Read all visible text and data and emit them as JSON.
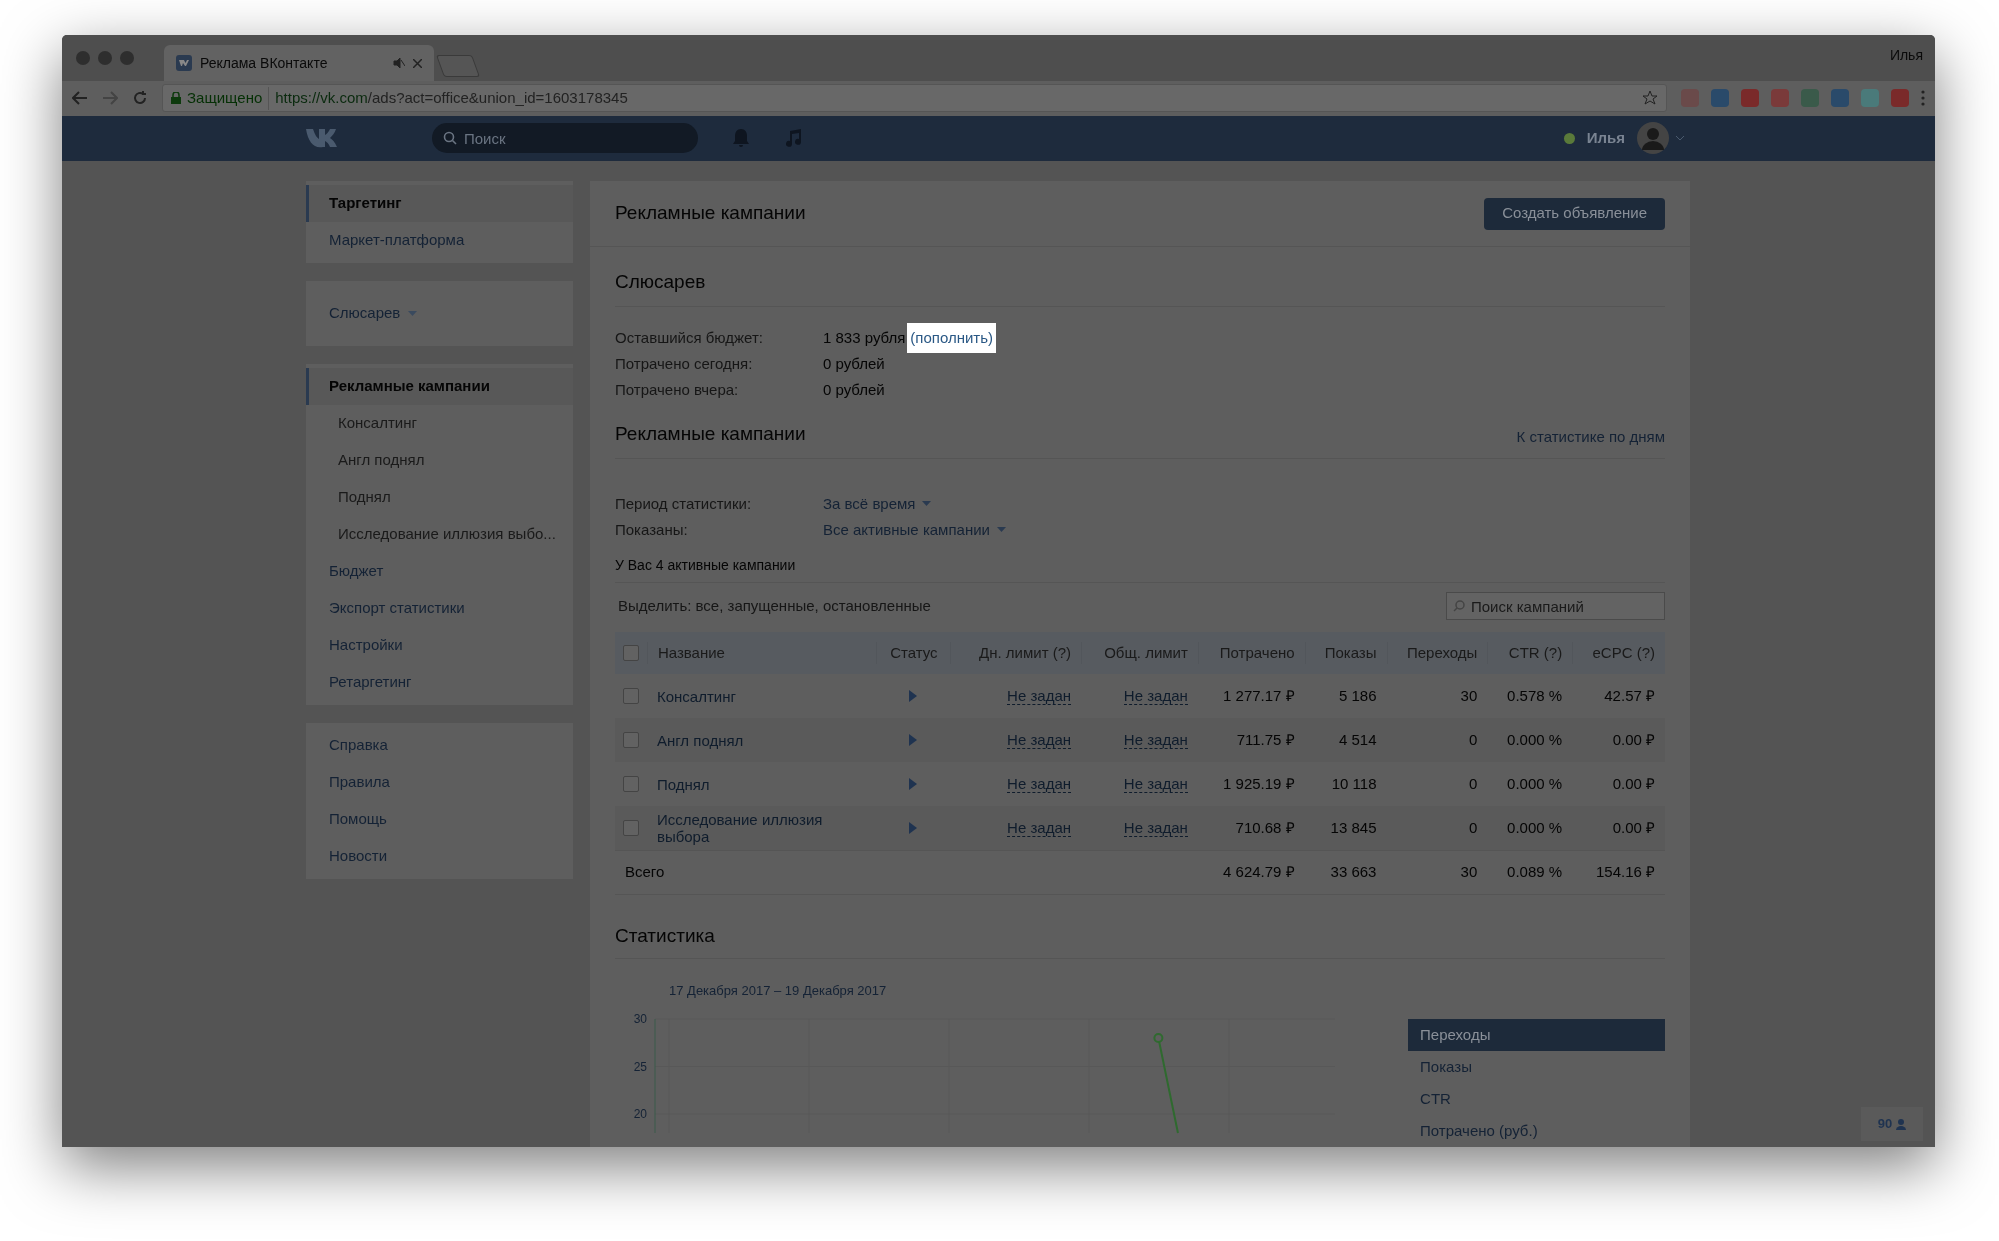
{
  "browser": {
    "tabs": [
      {
        "title": "Реклама ВКонтакте",
        "selected": true
      }
    ],
    "profile": "Илья",
    "security": "Защищено",
    "url_host": "https://vk.com",
    "url_path": "/ads?act=office&union_id=1603178345"
  },
  "vk_header": {
    "search": {
      "placeholder": "Поиск"
    },
    "user": "Илья",
    "online": true
  },
  "sidebar": {
    "groups": [
      {
        "items": [
          {
            "label": "Таргетинг",
            "selected": true
          },
          {
            "label": "Маркет-платформа",
            "selected": false
          }
        ]
      },
      {
        "items": [
          {
            "label": "Слюсарев",
            "kind": "dropdown",
            "selected": false
          }
        ]
      },
      {
        "items": [
          {
            "label": "Рекламные кампании",
            "selected": true,
            "children": [
              {
                "label": "Консалтинг",
                "selected": false
              },
              {
                "label": "Англ поднял",
                "selected": false
              },
              {
                "label": "Поднял",
                "selected": false
              },
              {
                "label": "Исследование иллюзия выбо...",
                "selected": false
              }
            ]
          },
          {
            "label": "Бюджет",
            "selected": false
          },
          {
            "label": "Экспорт статистики",
            "selected": false
          },
          {
            "label": "Настройки",
            "selected": false
          },
          {
            "label": "Ретаргетинг",
            "selected": false
          }
        ]
      },
      {
        "items": [
          {
            "label": "Справка",
            "selected": false
          },
          {
            "label": "Правила",
            "selected": false
          },
          {
            "label": "Помощь",
            "selected": false
          },
          {
            "label": "Новости",
            "selected": false
          }
        ]
      }
    ]
  },
  "main": {
    "title": "Рекламные кампании",
    "create_button": "Создать объявление",
    "account": {
      "title": "Слюсарев",
      "rows": [
        {
          "label": "Оставшийся бюджет:",
          "value": "1 833 рубля",
          "link": "(пополнить)",
          "highlighted": true
        },
        {
          "label": "Потрачено сегодня:",
          "value": "0 рублей"
        },
        {
          "label": "Потрачено вчера:",
          "value": "0 рублей"
        }
      ]
    },
    "campaigns": {
      "title": "Рекламные кампании",
      "stats_link": "К статистике по дням",
      "filters": [
        {
          "label": "Период статистики:",
          "value": "За всё время"
        },
        {
          "label": "Показаны:",
          "value": "Все активные кампании"
        }
      ],
      "count": "У Вас 4 активные кампании",
      "select_line": "Выделить: все, запущенные, остановленные",
      "search": {
        "placeholder": "Поиск кампаний"
      },
      "table": {
        "select_all": {
          "checked": false
        },
        "columns": [
          "Название",
          "Статус",
          "Дн. лимит (?)",
          "Общ. лимит",
          "Потрачено",
          "Показы",
          "Переходы",
          "CTR (?)",
          "eCPC (?)"
        ],
        "rows": [
          {
            "checked": false,
            "name": "Консалтинг",
            "running": true,
            "day_limit": "Не задан",
            "total_limit": "Не задан",
            "spent": "1 277.17 ₽",
            "shows": "5 186",
            "clicks": "30",
            "ctr": "0.578 %",
            "ecpc": "42.57 ₽"
          },
          {
            "checked": false,
            "name": "Англ поднял",
            "running": true,
            "day_limit": "Не задан",
            "total_limit": "Не задан",
            "spent": "711.75 ₽",
            "shows": "4 514",
            "clicks": "0",
            "ctr": "0.000 %",
            "ecpc": "0.00 ₽"
          },
          {
            "checked": false,
            "name": "Поднял",
            "running": true,
            "day_limit": "Не задан",
            "total_limit": "Не задан",
            "spent": "1 925.19 ₽",
            "shows": "10 118",
            "clicks": "0",
            "ctr": "0.000 %",
            "ecpc": "0.00 ₽"
          },
          {
            "checked": false,
            "name": "Исследование иллюзия выбора",
            "running": true,
            "day_limit": "Не задан",
            "total_limit": "Не задан",
            "spent": "710.68 ₽",
            "shows": "13 845",
            "clicks": "0",
            "ctr": "0.000 %",
            "ecpc": "0.00 ₽"
          }
        ],
        "total": {
          "label": "Всего",
          "spent": "4 624.79 ₽",
          "shows": "33 663",
          "clicks": "30",
          "ctr": "0.089 %",
          "ecpc": "154.16 ₽"
        }
      }
    },
    "statistics": {
      "title": "Статистика",
      "range": "17 Декабря 2017 – 19 Декабря 2017",
      "chart_data": {
        "type": "line",
        "categories": [
          null,
          null,
          null,
          null,
          null,
          null,
          null,
          null,
          null,
          null,
          null,
          null,
          null,
          null,
          null,
          null,
          null,
          null,
          null,
          null,
          null,
          null,
          null,
          null,
          null,
          null,
          null,
          null,
          null,
          null,
          null,
          null,
          null,
          null
        ],
        "ylim": [
          18,
          30
        ],
        "yticks": [
          20,
          25,
          30
        ],
        "series": [
          {
            "color": "#2f6a2f",
            "values": [
              null,
              null,
              null,
              null,
              null,
              null,
              null,
              null,
              null,
              null,
              null,
              null,
              null,
              null,
              null,
              null,
              null,
              null,
              null,
              null,
              null,
              null,
              null,
              null,
              null,
              28,
              18,
              null,
              null,
              null,
              null,
              null,
              null,
              null
            ]
          }
        ]
      },
      "metrics": [
        {
          "label": "Переходы",
          "selected": true
        },
        {
          "label": "Показы",
          "selected": false
        },
        {
          "label": "CTR",
          "selected": false
        },
        {
          "label": "Потрачено (руб.)",
          "selected": false
        }
      ]
    }
  },
  "online_badge": "90"
}
